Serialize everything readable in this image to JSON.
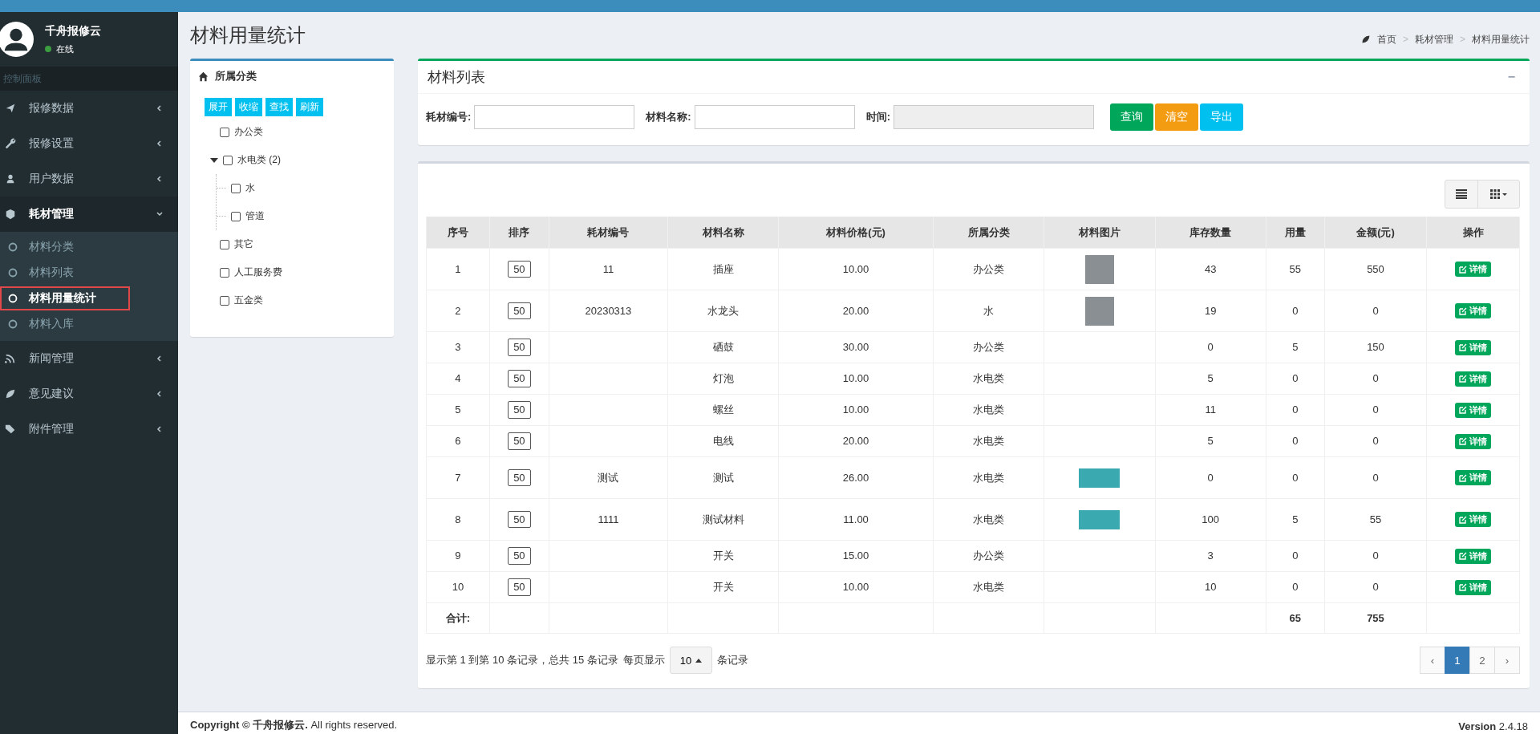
{
  "user": {
    "name": "千舟报修云",
    "status": "在线"
  },
  "sidebar": {
    "header": "控制面板",
    "items": [
      {
        "label": "报修数据",
        "expanded": false
      },
      {
        "label": "报修设置",
        "expanded": false
      },
      {
        "label": "用户数据",
        "expanded": false
      },
      {
        "label": "耗材管理",
        "expanded": true,
        "children": [
          {
            "label": "材料分类",
            "selected": false
          },
          {
            "label": "材料列表",
            "selected": false
          },
          {
            "label": "材料用量统计",
            "selected": true
          },
          {
            "label": "材料入库",
            "selected": false
          }
        ]
      },
      {
        "label": "新闻管理",
        "expanded": false
      },
      {
        "label": "意见建议",
        "expanded": false
      },
      {
        "label": "附件管理",
        "expanded": false
      }
    ]
  },
  "page_title": "材料用量统计",
  "breadcrumb": {
    "separator": ">",
    "items": [
      "首页",
      "耗材管理",
      "材料用量统计"
    ]
  },
  "category_panel": {
    "title": "所属分类",
    "buttons": [
      "展开",
      "收缩",
      "查找",
      "刷新"
    ],
    "tree": [
      {
        "label": "办公类",
        "checked": false
      },
      {
        "label": "水电类 (2)",
        "checked": false,
        "expanded": true,
        "children": [
          {
            "label": "水",
            "checked": false
          },
          {
            "label": "管道",
            "checked": false
          }
        ]
      },
      {
        "label": "其它",
        "checked": false
      },
      {
        "label": "人工服务费",
        "checked": false
      },
      {
        "label": "五金类",
        "checked": false
      }
    ]
  },
  "search_box": {
    "title": "材料列表",
    "collapse": "−",
    "fields": [
      {
        "label": "耗材编号:",
        "disabled": false
      },
      {
        "label": "材料名称:",
        "disabled": false
      },
      {
        "label": "时间:",
        "disabled": true
      }
    ],
    "buttons": [
      {
        "label": "查询",
        "kind": "success"
      },
      {
        "label": "清空",
        "kind": "warning"
      },
      {
        "label": "导出",
        "kind": "info"
      }
    ]
  },
  "table": {
    "columns": [
      "序号",
      "排序",
      "耗材编号",
      "材料名称",
      "材料价格(元)",
      "所属分类",
      "材料图片",
      "库存数量",
      "用量",
      "金额(元)",
      "操作"
    ],
    "rows": [
      {
        "no": "1",
        "sort": "50",
        "code": "11",
        "name": "插座",
        "price": "10.00",
        "category": "办公类",
        "photo": true,
        "wide_photo": false,
        "stock": "43",
        "usage": "55",
        "amount": "550",
        "action": "详情"
      },
      {
        "no": "2",
        "sort": "50",
        "code": "20230313",
        "name": "水龙头",
        "price": "20.00",
        "category": "水",
        "photo": true,
        "wide_photo": false,
        "stock": "19",
        "usage": "0",
        "amount": "0",
        "action": "详情"
      },
      {
        "no": "3",
        "sort": "50",
        "name": "硒鼓",
        "price": "30.00",
        "category": "办公类",
        "stock": "0",
        "usage": "5",
        "amount": "150",
        "action": "详情"
      },
      {
        "no": "4",
        "sort": "50",
        "name": "灯泡",
        "price": "10.00",
        "category": "水电类",
        "stock": "5",
        "usage": "0",
        "amount": "0",
        "action": "详情"
      },
      {
        "no": "5",
        "sort": "50",
        "name": "螺丝",
        "price": "10.00",
        "category": "水电类",
        "stock": "11",
        "usage": "0",
        "amount": "0",
        "action": "详情"
      },
      {
        "no": "6",
        "sort": "50",
        "name": "电线",
        "price": "20.00",
        "category": "水电类",
        "stock": "5",
        "usage": "0",
        "amount": "0",
        "action": "详情"
      },
      {
        "no": "7",
        "sort": "50",
        "code": "测试",
        "name": "测试",
        "price": "26.00",
        "category": "水电类",
        "photo": true,
        "wide_photo": true,
        "stock": "0",
        "usage": "0",
        "amount": "0",
        "action": "详情"
      },
      {
        "no": "8",
        "sort": "50",
        "code": "1111",
        "name": "测试材料",
        "price": "11.00",
        "category": "水电类",
        "photo": true,
        "wide_photo": true,
        "stock": "100",
        "usage": "5",
        "amount": "55",
        "action": "详情"
      },
      {
        "no": "9",
        "sort": "50",
        "name": "开关",
        "price": "15.00",
        "category": "办公类",
        "stock": "3",
        "usage": "0",
        "amount": "0",
        "action": "详情"
      },
      {
        "no": "10",
        "sort": "50",
        "name": "开关",
        "price": "10.00",
        "category": "水电类",
        "stock": "10",
        "usage": "0",
        "amount": "0",
        "action": "详情"
      }
    ],
    "totals": {
      "label": "合计:",
      "usage": "65",
      "amount": "755"
    }
  },
  "pagination": {
    "info": "显示第 1 到第 10 条记录，总共 15 条记录",
    "per_page_label": "每页显示",
    "page_size": "10",
    "per_page_suffix": "条记录",
    "prev": "‹",
    "next": "›",
    "pages": [
      {
        "label": "1",
        "selected": true
      },
      {
        "label": "2",
        "selected": false
      }
    ]
  },
  "footer": {
    "copyright": "**Copyright © 千舟报修云.** All rights reserved.",
    "version": "**Version** 2.4.18"
  }
}
